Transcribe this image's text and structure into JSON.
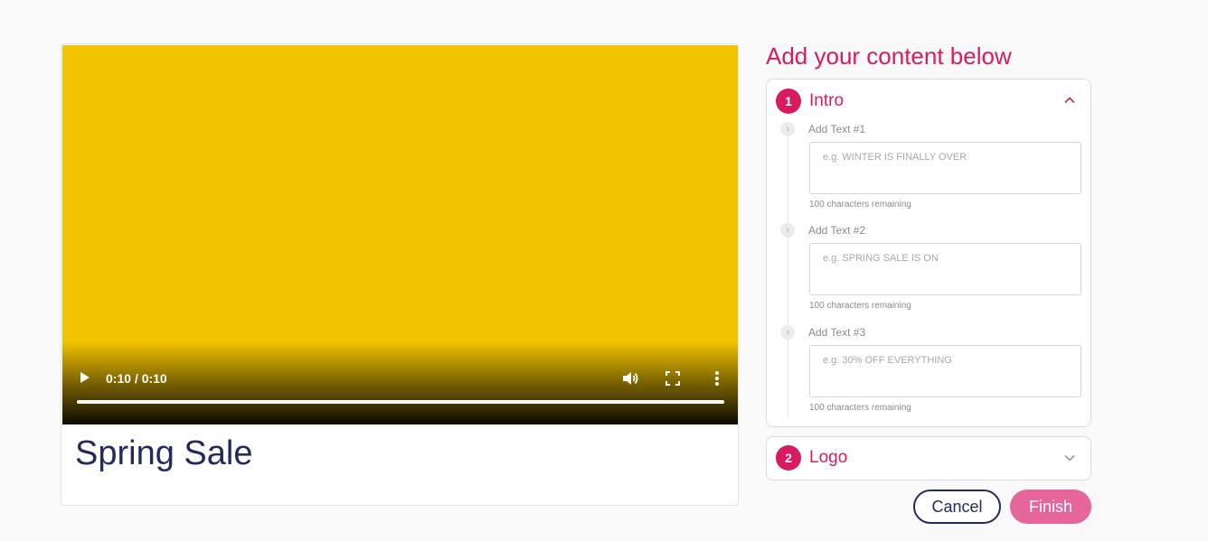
{
  "preview": {
    "title": "Spring Sale",
    "video": {
      "background_color": "#f2c300",
      "time_display": "0:10 / 0:10",
      "progress_fraction": 1.0
    }
  },
  "panel": {
    "heading": "Add your content below",
    "sections": [
      {
        "number": "1",
        "title": "Intro",
        "expanded": true,
        "fields": [
          {
            "label": "Add Text #1",
            "placeholder": "e.g. WINTER IS FINALLY OVER",
            "value": "",
            "remaining": "100 characters remaining"
          },
          {
            "label": "Add Text #2",
            "placeholder": "e.g. SPRING SALE IS ON",
            "value": "",
            "remaining": "100 characters remaining"
          },
          {
            "label": "Add Text #3",
            "placeholder": "e.g. 30% OFF EVERYTHING",
            "value": "",
            "remaining": "100 characters remaining"
          }
        ]
      },
      {
        "number": "2",
        "title": "Logo",
        "expanded": false
      }
    ]
  },
  "actions": {
    "cancel_label": "Cancel",
    "finish_label": "Finish"
  },
  "colors": {
    "accent": "#d81b60",
    "navy": "#252a5c",
    "finish_button": "#e7669a"
  }
}
